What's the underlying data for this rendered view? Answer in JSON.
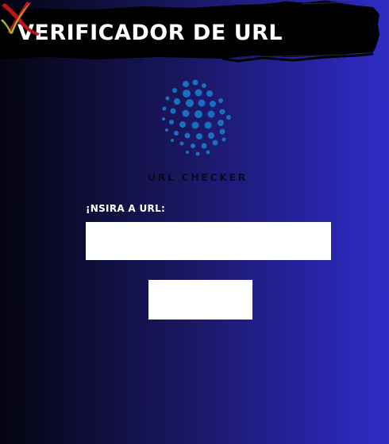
{
  "banner": {
    "title": "VERIFICADOR DE URL",
    "invalid_icon": "x-mark-icon",
    "valid_icon": "check-mark-icon",
    "invalid_color": "#c0141a",
    "valid_color": "#9ab836"
  },
  "logo": {
    "icon": "dotted-globe-icon",
    "text": "URL CHECKER",
    "color": "#1a6fc0"
  },
  "form": {
    "url_label": "¡NSIRA A URL:",
    "url_value": "",
    "url_placeholder": "",
    "submit_label": ""
  },
  "colors": {
    "background_start": "#040410",
    "background_end": "#2f2cc4",
    "field_background": "#ffffff"
  }
}
